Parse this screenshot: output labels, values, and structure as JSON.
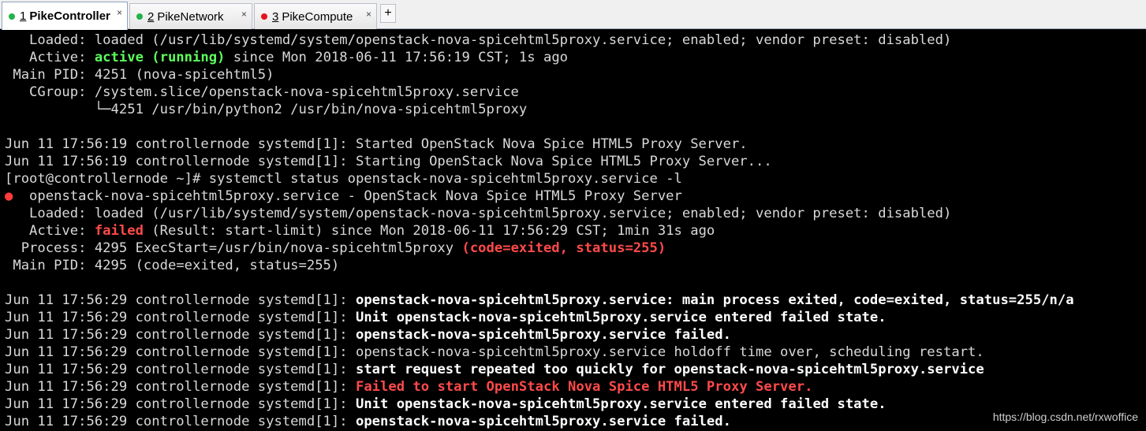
{
  "tabs": [
    {
      "num": "1",
      "label": "PikeController",
      "dot_color": "#22b14c",
      "close": "×"
    },
    {
      "num": "2",
      "label": "PikeNetwork",
      "dot_color": "#22b14c",
      "close": "×"
    },
    {
      "num": "3",
      "label": "PikeCompute",
      "dot_color": "#e81123",
      "close": "×"
    }
  ],
  "add_tab_label": "+",
  "terminal": {
    "l1": "   Loaded: loaded (/usr/lib/systemd/system/openstack-nova-spicehtml5proxy.service; enabled; vendor preset: disabled)",
    "l2_a": "   Active: ",
    "l2_b": "active (running)",
    "l2_c": " since Mon 2018-06-11 17:56:19 CST; 1s ago",
    "l3": " Main PID: 4251 (nova-spicehtml5)",
    "l4": "   CGroup: /system.slice/openstack-nova-spicehtml5proxy.service",
    "l5": "           └─4251 /usr/bin/python2 /usr/bin/nova-spicehtml5proxy",
    "l7": "Jun 11 17:56:19 controllernode systemd[1]: Started OpenStack Nova Spice HTML5 Proxy Server.",
    "l8": "Jun 11 17:56:19 controllernode systemd[1]: Starting OpenStack Nova Spice HTML5 Proxy Server...",
    "l9": "[root@controllernode ~]# systemctl status openstack-nova-spicehtml5proxy.service -l",
    "l10_bullet": "●",
    "l10_b": "  openstack-nova-spicehtml5proxy.service - OpenStack Nova Spice HTML5 Proxy Server",
    "l11": "   Loaded: loaded (/usr/lib/systemd/system/openstack-nova-spicehtml5proxy.service; enabled; vendor preset: disabled)",
    "l12_a": "   Active: ",
    "l12_b": "failed",
    "l12_c": " (Result: start-limit) since Mon 2018-06-11 17:56:29 CST; 1min 31s ago",
    "l13_a": "  Process: 4295 ExecStart=/usr/bin/nova-spicehtml5proxy ",
    "l13_b": "(code=exited, status=255)",
    "l14": " Main PID: 4295 (code=exited, status=255)",
    "prefix": "Jun 11 17:56:29 controllernode systemd[1]: ",
    "m1": "openstack-nova-spicehtml5proxy.service: main process exited, code=exited, status=255/n/a",
    "m2": "Unit openstack-nova-spicehtml5proxy.service entered failed state.",
    "m3": "openstack-nova-spicehtml5proxy.service failed.",
    "m4": "openstack-nova-spicehtml5proxy.service holdoff time over, scheduling restart.",
    "m5": "start request repeated too quickly for openstack-nova-spicehtml5proxy.service",
    "m6": "Failed to start OpenStack Nova Spice HTML5 Proxy Server.",
    "m7": "Unit openstack-nova-spicehtml5proxy.service entered failed state.",
    "m8": "openstack-nova-spicehtml5proxy.service failed."
  },
  "watermark": "https://blog.csdn.net/rxwoffice",
  "colors": {
    "green": "#5dff5d",
    "red": "#ff4a4a",
    "text": "#d9d9d9",
    "bright": "#ffffff"
  }
}
